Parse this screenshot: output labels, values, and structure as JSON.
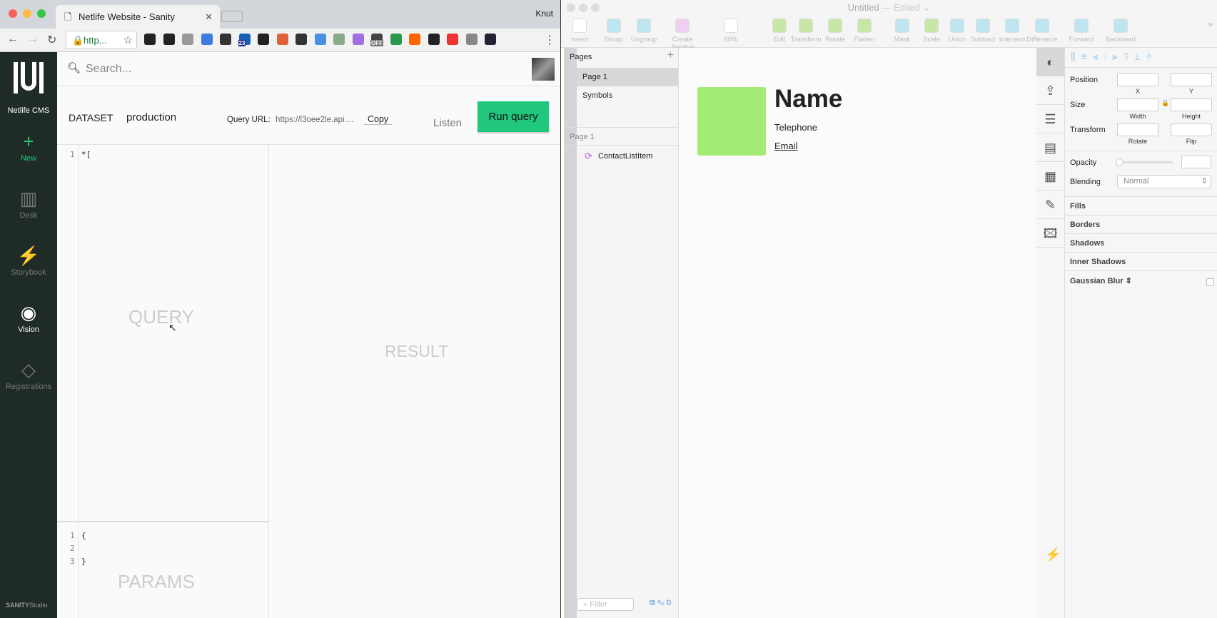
{
  "browser": {
    "tab_title": "Netlife Website - Sanity",
    "profile": "Knut",
    "url": "http...",
    "extensions": [
      "github-icon",
      "instapaper-icon",
      "extension-icon",
      "lighthouse-icon",
      "onepassword-icon",
      "badge-23-icon",
      "panda-icon",
      "color-icon",
      "github-icon",
      "extension-icon",
      "js-icon",
      "extension-icon",
      "off-icon",
      "extension-icon",
      "extension-icon",
      "extension-icon",
      "colors-icon",
      "inspect-icon",
      "react-icon"
    ],
    "badge": "23",
    "off": "OFF"
  },
  "cms": {
    "logo_text": "Netlife CMS",
    "nav": [
      {
        "label": "New",
        "icon": "plus-icon"
      },
      {
        "label": "Desk",
        "icon": "desk-icon"
      },
      {
        "label": "Storybook",
        "icon": "plug-icon"
      },
      {
        "label": "Vision",
        "icon": "eye-icon"
      },
      {
        "label": "Registrations",
        "icon": "tag-icon"
      }
    ],
    "footer_brand": "SANITY",
    "footer_sub": "Studio",
    "search_placeholder": "Search..."
  },
  "vision": {
    "dataset_label": "DATASET",
    "dataset_value": "production",
    "query_url_label": "Query URL:",
    "query_url": "https://l3oee2le.api....",
    "copy": "Copy",
    "listen": "Listen",
    "run": "Run query",
    "query_lines": [
      "1"
    ],
    "query_text": "*[",
    "query_ghost": "QUERY",
    "result_ghost": "RESULT",
    "params_lines": [
      "1",
      "2",
      "3"
    ],
    "params_text": [
      "{",
      "",
      "}"
    ],
    "params_ghost": "PARAMS"
  },
  "sketch": {
    "title": "Untitled",
    "edited": "— Edited ⌄",
    "tools": [
      {
        "label": "Insert",
        "color": "#fff"
      },
      {
        "label": "Group",
        "color": "#bde6f0"
      },
      {
        "label": "Ungroup",
        "color": "#bde6f0"
      },
      {
        "label": "Create Symbol",
        "color": "#f0d0f0"
      },
      {
        "label": "60%",
        "color": "#fff"
      },
      {
        "label": "Edit",
        "color": "#c8e6a8"
      },
      {
        "label": "Transform",
        "color": "#c8e6a8"
      },
      {
        "label": "Rotate",
        "color": "#c8e6a8"
      },
      {
        "label": "Flatten",
        "color": "#c8e6a8"
      },
      {
        "label": "Mask",
        "color": "#bde6f0"
      },
      {
        "label": "Scale",
        "color": "#c8e6a8"
      },
      {
        "label": "Union",
        "color": "#bde6f0"
      },
      {
        "label": "Subtract",
        "color": "#bde6f0"
      },
      {
        "label": "Intersect",
        "color": "#bde6f0"
      },
      {
        "label": "Difference",
        "color": "#bde6f0"
      },
      {
        "label": "Forward",
        "color": "#bde6f0"
      },
      {
        "label": "Backward",
        "color": "#bde6f0"
      }
    ],
    "pages_title": "Pages",
    "pages": [
      "Page 1",
      "Symbols"
    ],
    "layers_title": "Page 1",
    "layers": [
      "ContactListItem"
    ],
    "filter_placeholder": "Filter",
    "edit_count": "0",
    "artboard": {
      "name": "Name",
      "telephone": "Telephone",
      "email": "Email",
      "swatch": "#a4ec75"
    },
    "inspector": {
      "position": "Position",
      "x": "X",
      "y": "Y",
      "size": "Size",
      "width": "Width",
      "height": "Height",
      "transform": "Transform",
      "rotate": "Rotate",
      "flip": "Flip",
      "opacity": "Opacity",
      "opacity_value": 0,
      "blending": "Blending",
      "blending_value": "Normal",
      "sections": [
        "Fills",
        "Borders",
        "Shadows",
        "Inner Shadows",
        "Gaussian Blur ⇕"
      ]
    }
  }
}
